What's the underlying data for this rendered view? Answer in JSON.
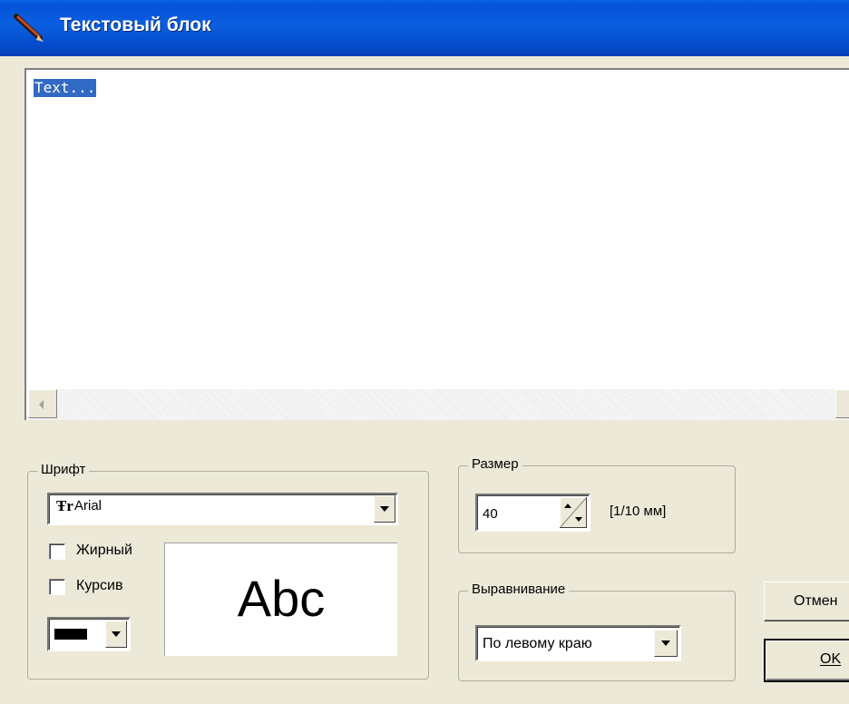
{
  "window": {
    "title": "Текстовый блок",
    "icon": "pencil-icon"
  },
  "editor": {
    "selected_text": "Text..."
  },
  "font_group": {
    "legend": "Шрифт",
    "font_name": "Arial",
    "font_icon": "Ŧr",
    "bold_label": "Жирный",
    "bold_checked": false,
    "italic_label": "Курсив",
    "italic_checked": false,
    "color": "#000000",
    "preview_text": "Abc"
  },
  "size_group": {
    "legend": "Размер",
    "value": "40",
    "unit": "[1/10 мм]"
  },
  "align_group": {
    "legend": "Выравнивание",
    "value": "По левому краю"
  },
  "buttons": {
    "cancel": "Отмен",
    "ok": "OK"
  }
}
